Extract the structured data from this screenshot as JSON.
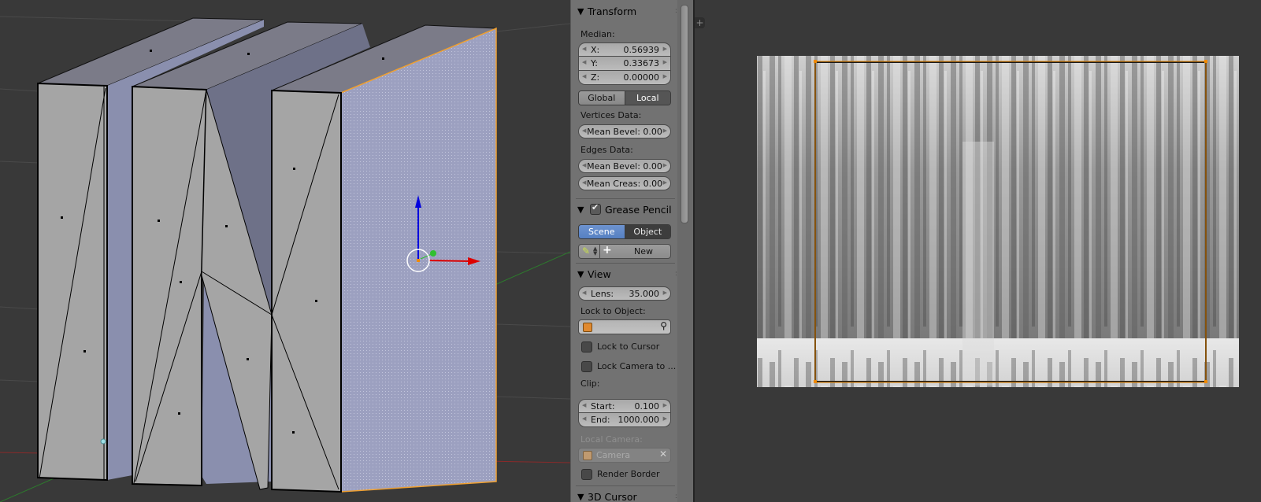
{
  "viewport": {
    "objects": [
      "panel-left",
      "panel-middle",
      "panel-right-selected"
    ],
    "manipulator": {
      "axes": [
        "x-red",
        "y-green",
        "z-blue"
      ]
    },
    "colors": {
      "background": "#393939",
      "face": "#a5a5a5",
      "side": "#8a8fae",
      "top": "#7b7b88",
      "selected_outline": "#f0a030",
      "selected_face": "#9da1c2"
    }
  },
  "npanel": {
    "transform": {
      "header": "Transform",
      "median_label": "Median:",
      "x_label": "X:",
      "x_value": "0.56939",
      "y_label": "Y:",
      "y_value": "0.33673",
      "z_label": "Z:",
      "z_value": "0.00000",
      "global_label": "Global",
      "local_label": "Local",
      "active_space": "Local",
      "vertices_data_label": "Vertices Data:",
      "vertex_mean_bevel": "Mean Bevel: 0.00",
      "edges_data_label": "Edges Data:",
      "edge_mean_bevel": "Mean Bevel: 0.00",
      "edge_mean_crease": "Mean Creas: 0.00"
    },
    "grease_pencil": {
      "header": "Grease Pencil",
      "enabled": true,
      "scene_label": "Scene",
      "object_label": "Object",
      "active_source": "Scene",
      "new_label": "New"
    },
    "view": {
      "header": "View",
      "lens_label": "Lens:",
      "lens_value": "35.000",
      "lock_to_object_label": "Lock to Object:",
      "lock_to_object_value": "",
      "lock_to_cursor_label": "Lock to Cursor",
      "lock_to_cursor_checked": false,
      "lock_camera_label": "Lock Camera to ...",
      "lock_camera_checked": false,
      "clip_label": "Clip:",
      "clip_start_label": "Start:",
      "clip_start_value": "0.100",
      "clip_end_label": "End:",
      "clip_end_value": "1000.000",
      "local_camera_label": "Local Camera:",
      "local_camera_value": "Camera",
      "render_border_label": "Render Border",
      "render_border_checked": false
    },
    "cursor_3d": {
      "header": "3D Cursor"
    }
  },
  "image_editor": {
    "add_region_icon": "+",
    "uv_bounds_color": "#f08a00"
  }
}
